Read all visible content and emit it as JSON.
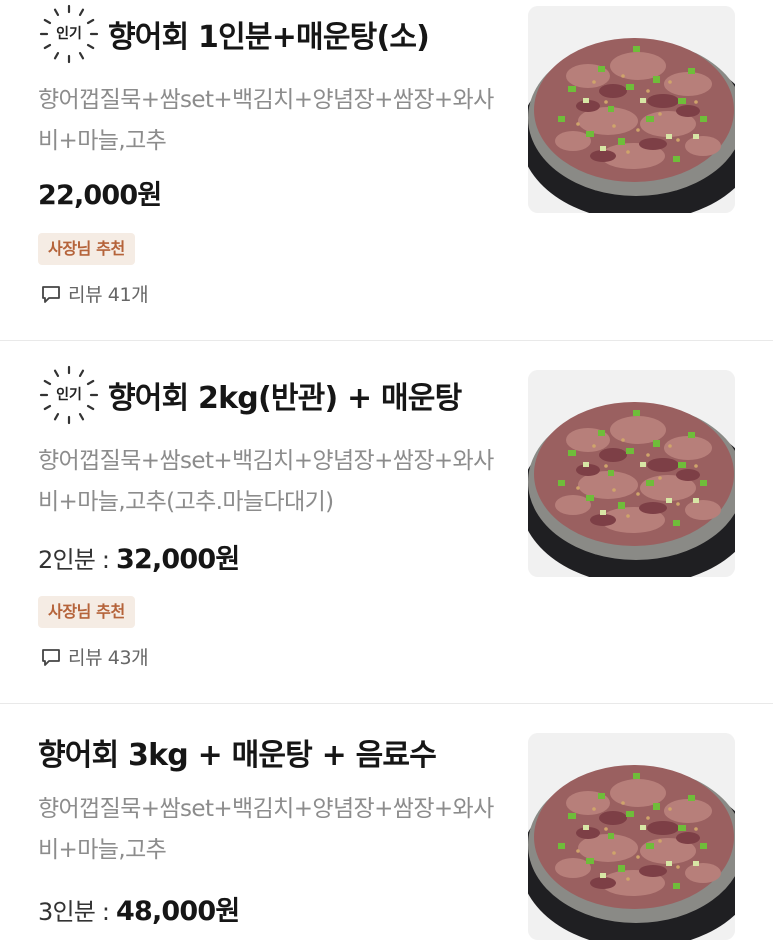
{
  "menu": {
    "items": [
      {
        "popular_badge": "인기",
        "title": "향어회 1인분+매운탕(소)",
        "description": "향어껍질묵+쌈set+백김치+양념장+쌈장+와사비+마늘,고추",
        "serving_label": "",
        "price": "22,000원",
        "owner_badge": "사장님 추천",
        "review_text": "리뷰 41개",
        "image_name": "sliced-fish-platter-image"
      },
      {
        "popular_badge": "인기",
        "title": "향어회 2kg(반관) + 매운탕",
        "description": "향어껍질묵+쌈set+백김치+양념장+쌈장+와사비+마늘,고추(고추.마늘다대기)",
        "serving_label": "2인분 : ",
        "price": "32,000원",
        "owner_badge": "사장님 추천",
        "review_text": "리뷰 43개",
        "image_name": "sliced-fish-platter-image"
      },
      {
        "title": "향어회 3kg + 매운탕 + 음료수",
        "description": "향어껍질묵+쌈set+백김치+양념장+쌈장+와사비+마늘,고추",
        "serving_label": "3인분 : ",
        "price": "48,000원",
        "image_name": "sliced-fish-platter-image"
      }
    ]
  },
  "colors": {
    "owner_badge_bg": "#f5ece4",
    "owner_badge_text": "#b5633a",
    "description_text": "#8c8c8c",
    "divider": "#e9e9e9"
  }
}
